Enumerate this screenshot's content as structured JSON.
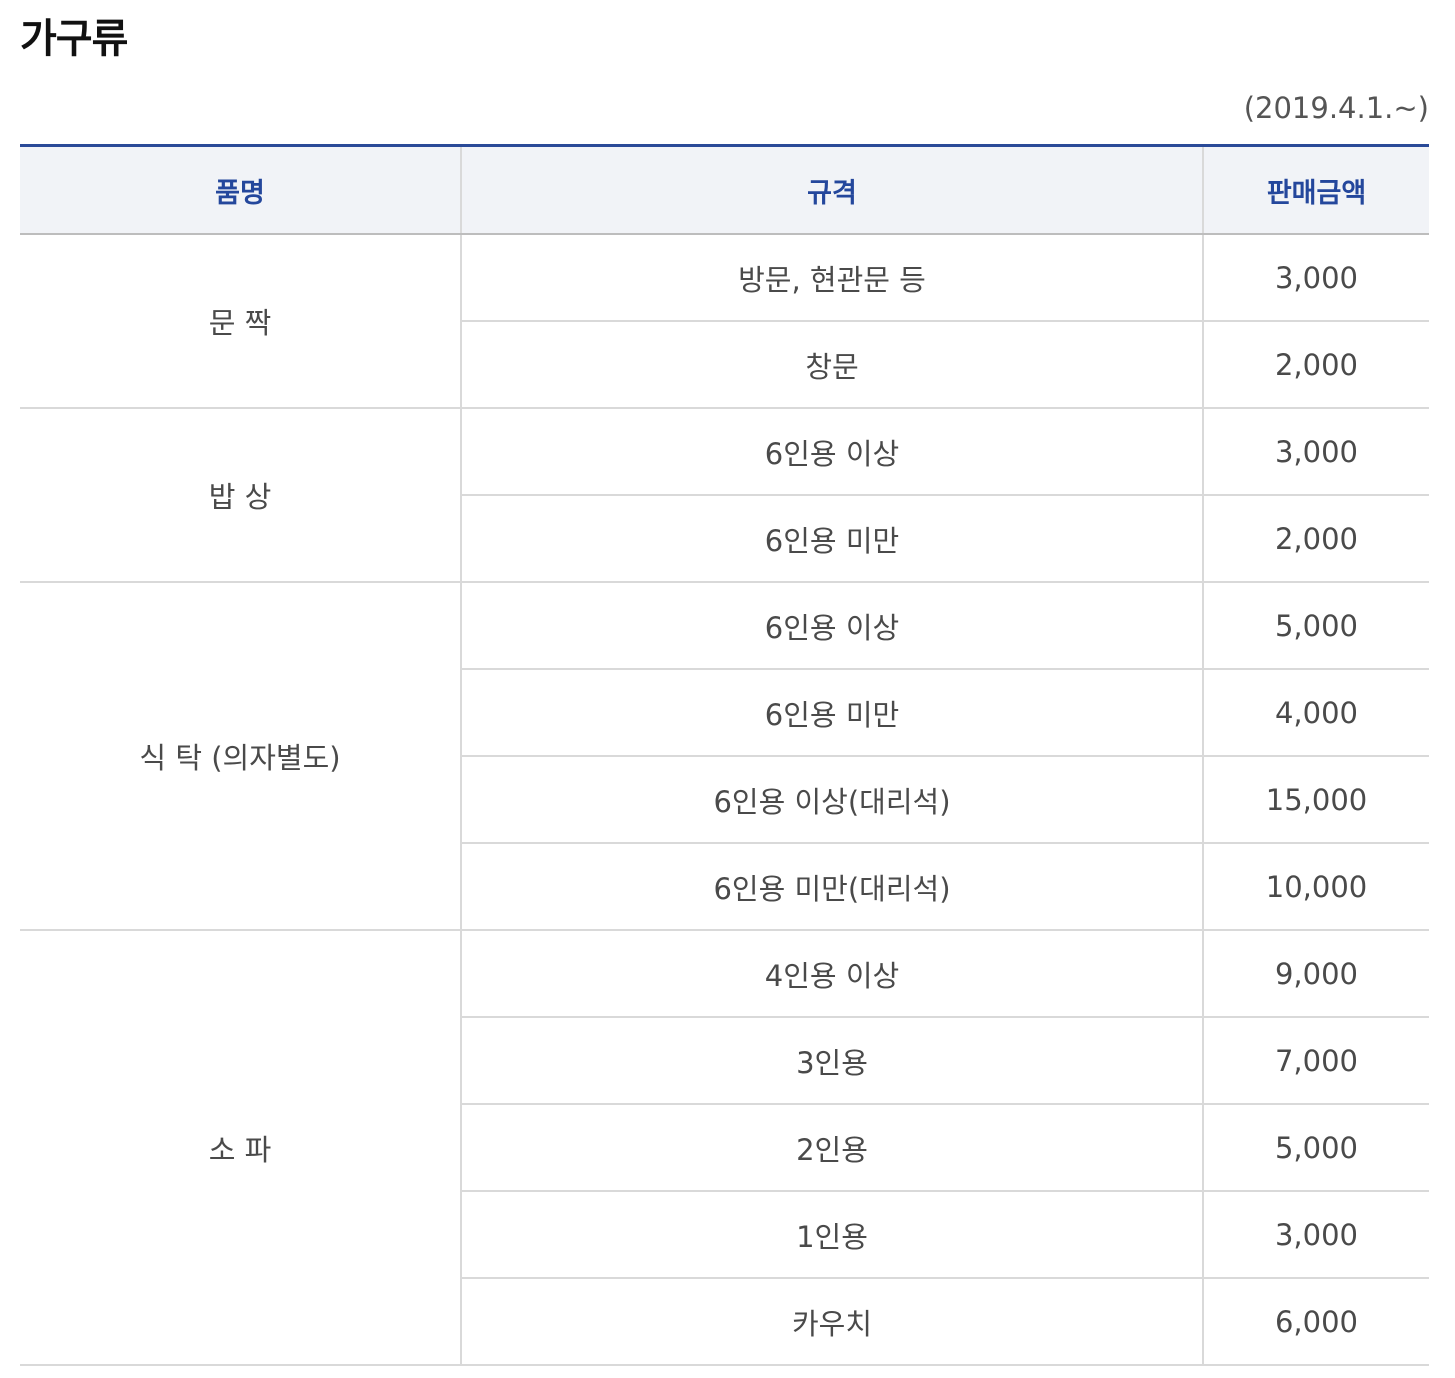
{
  "title": "가구류",
  "effective_date": "(2019.4.1.~)",
  "table": {
    "headers": [
      "품명",
      "규격",
      "판매금액"
    ],
    "groups": [
      {
        "item": "문 짝",
        "rows": [
          {
            "spec": "방문, 현관문 등",
            "price": "3,000"
          },
          {
            "spec": "창문",
            "price": "2,000"
          }
        ]
      },
      {
        "item": "밥 상",
        "rows": [
          {
            "spec": "6인용 이상",
            "price": "3,000"
          },
          {
            "spec": "6인용 미만",
            "price": "2,000"
          }
        ]
      },
      {
        "item": "식 탁 (의자별도)",
        "rows": [
          {
            "spec": "6인용 이상",
            "price": "5,000"
          },
          {
            "spec": "6인용 미만",
            "price": "4,000"
          },
          {
            "spec": "6인용 이상(대리석)",
            "price": "15,000"
          },
          {
            "spec": "6인용 미만(대리석)",
            "price": "10,000"
          }
        ]
      },
      {
        "item": "소 파",
        "rows": [
          {
            "spec": "4인용 이상",
            "price": "9,000"
          },
          {
            "spec": "3인용",
            "price": "7,000"
          },
          {
            "spec": "2인용",
            "price": "5,000"
          },
          {
            "spec": "1인용",
            "price": "3,000"
          },
          {
            "spec": "카우치",
            "price": "6,000"
          }
        ]
      }
    ]
  }
}
